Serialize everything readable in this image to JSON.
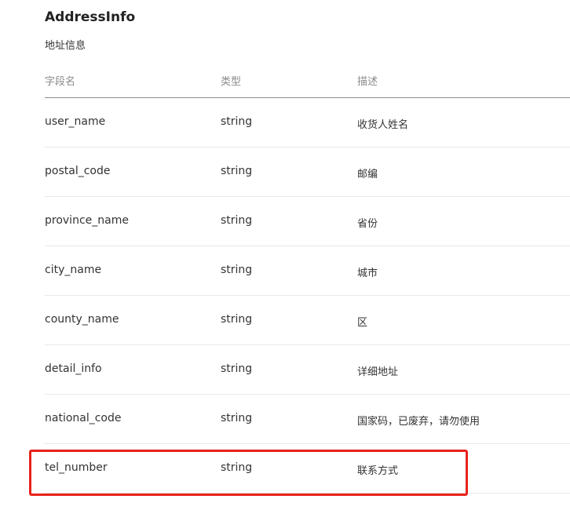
{
  "section": {
    "title": "AddressInfo",
    "subtitle": "地址信息"
  },
  "table": {
    "headers": {
      "name": "字段名",
      "type": "类型",
      "desc": "描述"
    },
    "rows": [
      {
        "name": "user_name",
        "type": "string",
        "desc": "收货人姓名"
      },
      {
        "name": "postal_code",
        "type": "string",
        "desc": "邮编"
      },
      {
        "name": "province_name",
        "type": "string",
        "desc": "省份"
      },
      {
        "name": "city_name",
        "type": "string",
        "desc": "城市"
      },
      {
        "name": "county_name",
        "type": "string",
        "desc": "区"
      },
      {
        "name": "detail_info",
        "type": "string",
        "desc": "详细地址"
      },
      {
        "name": "national_code",
        "type": "string",
        "desc": "国家码，已废弃，请勿使用"
      },
      {
        "name": "tel_number",
        "type": "string",
        "desc": "联系方式"
      }
    ]
  },
  "highlight": {
    "row_index": 7,
    "color": "#e8221b"
  }
}
